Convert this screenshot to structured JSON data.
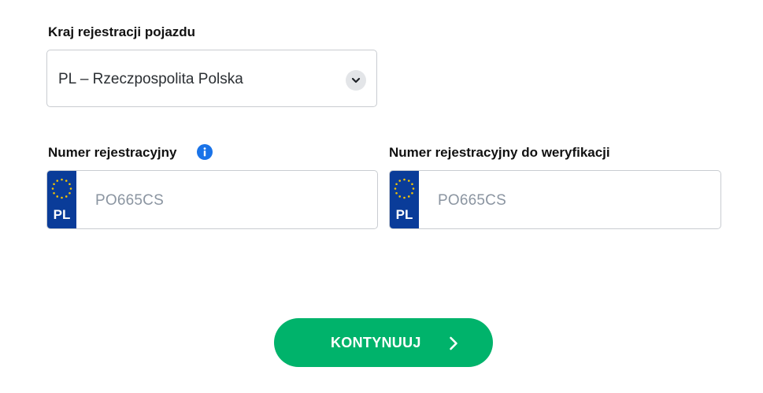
{
  "country": {
    "label": "Kraj rejestracji pojazdu",
    "selected": "PL – Rzeczpospolita Polska",
    "icon": "chevron-down-icon"
  },
  "registration": {
    "label": "Numer rejestracyjny",
    "info_icon": "info-icon",
    "country_code": "PL",
    "placeholder": "PO665CS"
  },
  "verification": {
    "label": "Numer rejestracyjny do weryfikacji",
    "country_code": "PL",
    "placeholder": "PO665CS"
  },
  "continue_button": {
    "label": "KONTYNUUJ",
    "icon": "chevron-right-icon",
    "color": "#00b36b"
  },
  "colors": {
    "eu_blue": "#0a3c99",
    "eu_star": "#f5c400",
    "info_blue": "#1a73e8"
  }
}
